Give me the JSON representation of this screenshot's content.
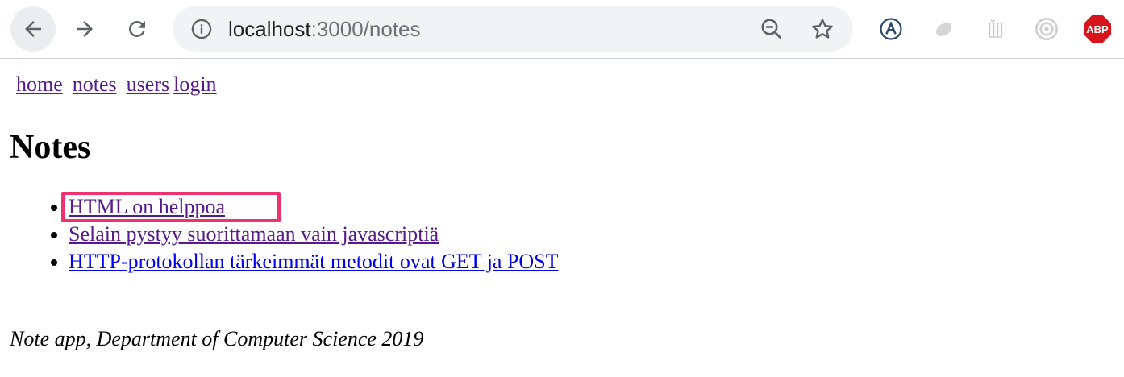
{
  "browser": {
    "url_host": "localhost",
    "url_path": ":3000/notes",
    "icons": {
      "back": "back-arrow-icon",
      "forward": "forward-arrow-icon",
      "reload": "reload-icon",
      "info": "info-icon",
      "zoom": "zoom-out-icon",
      "bookmark": "star-icon"
    },
    "extensions": {
      "ext1": "translate-a-icon",
      "ext2": "gray-blob-extension-icon",
      "ext3": "grid-extension-icon",
      "ext4": "target-extension-icon",
      "abp_label": "ABP"
    }
  },
  "nav": {
    "home": "home",
    "notes": "notes",
    "users": "users",
    "login": "login"
  },
  "heading": "Notes",
  "notes": [
    {
      "text": "HTML on helppoa"
    },
    {
      "text": "Selain pystyy suorittamaan vain javascriptiä"
    },
    {
      "text": "HTTP-protokollan tärkeimmät metodit ovat GET ja POST"
    }
  ],
  "footer": "Note app, Department of Computer Science 2019",
  "colors": {
    "visited_link": "#551a8b",
    "unvisited_link": "#0000ee",
    "highlight": "#f0326e",
    "abp_red": "#d8141c"
  }
}
